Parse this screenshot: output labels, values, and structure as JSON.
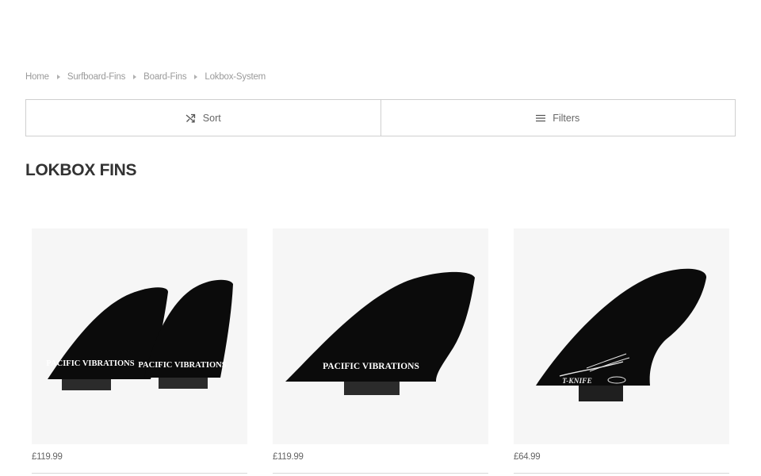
{
  "breadcrumb": [
    "Home",
    "Surfboard-Fins",
    "Board-Fins",
    "Lokbox-System"
  ],
  "toolbar": {
    "sort_label": "Sort",
    "filters_label": "Filters"
  },
  "page": {
    "title": "LOKBOX FINS"
  },
  "products": [
    {
      "price": "£119.99",
      "image": "twin-fins-pacific-vibrations",
      "fin_logo": "PACIFIC VIBRATIONS"
    },
    {
      "price": "£119.99",
      "image": "single-keel-fin-pacific-vibrations",
      "fin_logo": "PACIFIC VIBRATIONS"
    },
    {
      "price": "£64.99",
      "image": "fin-winged-logo",
      "fin_logo": "T-KNIFE"
    }
  ]
}
